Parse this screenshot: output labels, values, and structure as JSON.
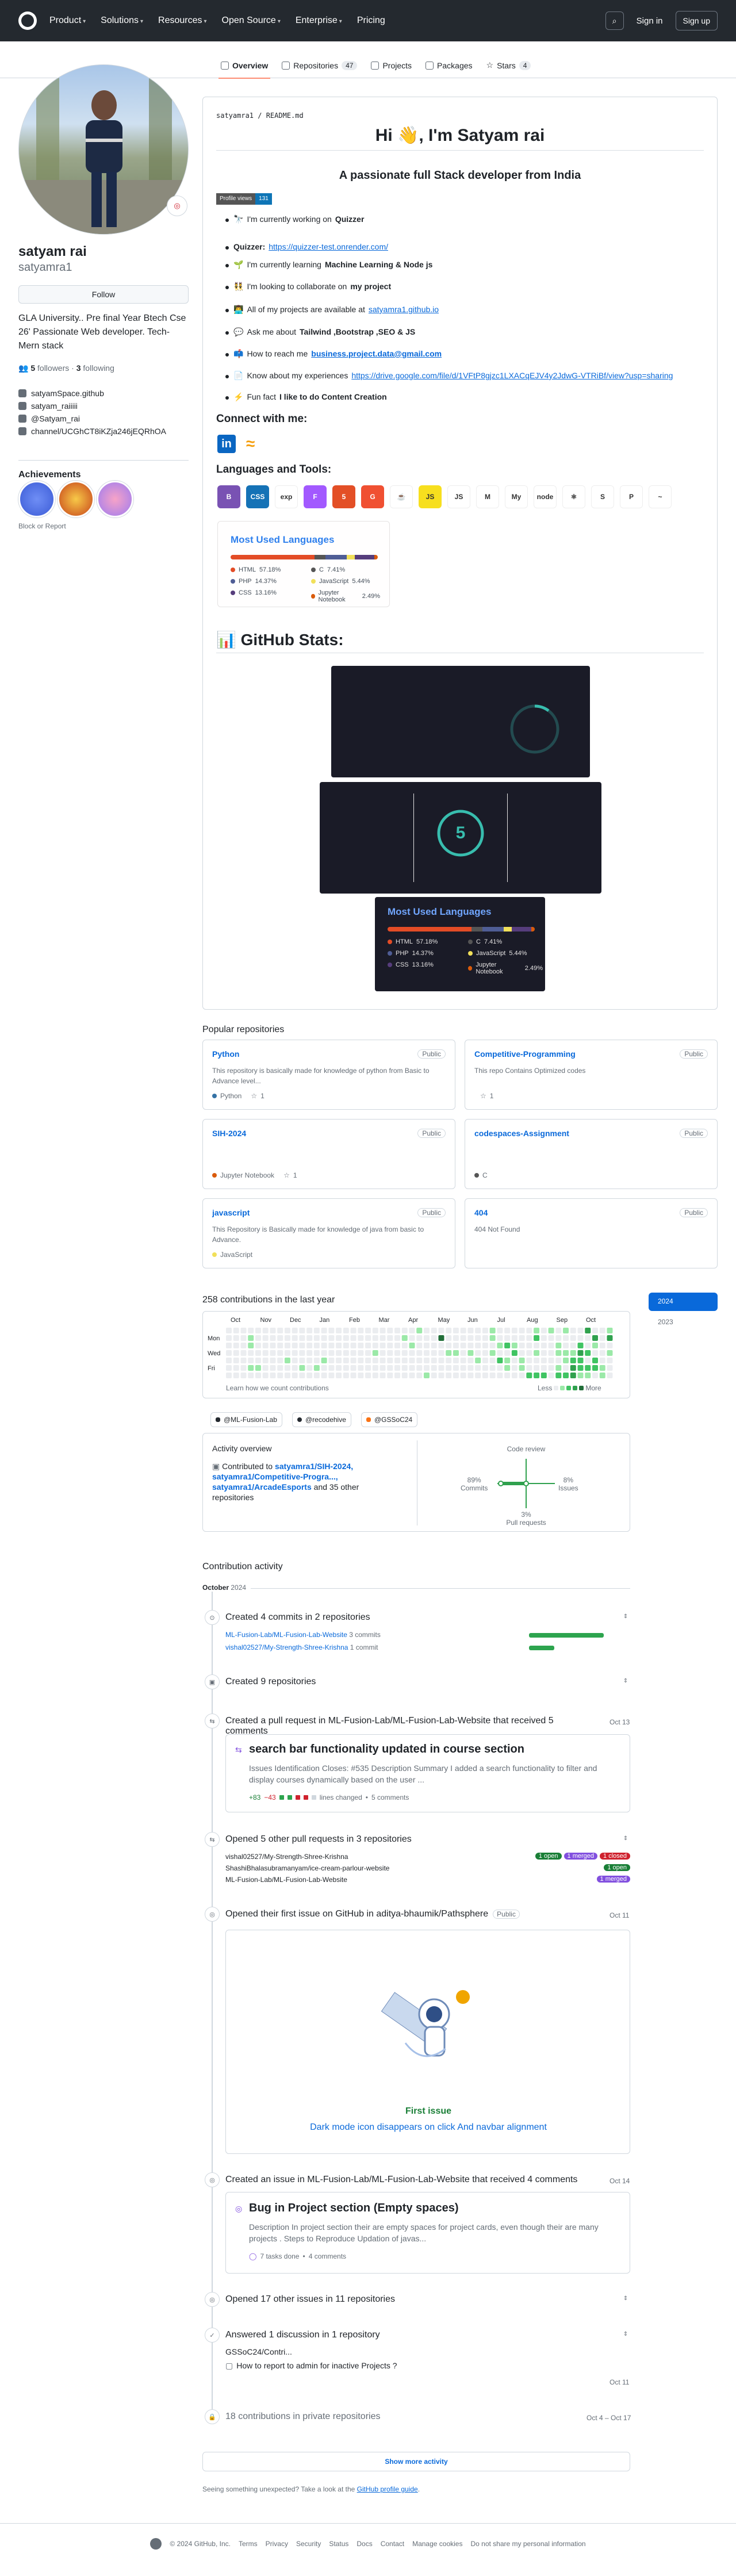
{
  "header": {
    "nav": [
      "Product",
      "Solutions",
      "Resources",
      "Open Source",
      "Enterprise",
      "Pricing"
    ],
    "signin": "Sign in",
    "signup": "Sign up"
  },
  "tabs": [
    {
      "label": "Overview"
    },
    {
      "label": "Repositories",
      "count": "47"
    },
    {
      "label": "Projects"
    },
    {
      "label": "Packages"
    },
    {
      "label": "Stars",
      "count": "4"
    }
  ],
  "profile": {
    "name": "satyam rai",
    "login": "satyamra1",
    "follow": "Follow",
    "bio": "GLA University.. Pre final Year Btech Cse 26' Passionate Web developer. Tech-Mern stack",
    "followers": "5",
    "followers_label": "followers",
    "following": "3",
    "following_label": "following",
    "links": [
      "satyamSpace.github",
      "satyam_raiiiii",
      "@Satyam_rai",
      "channel/UCGhCT8iKZja246jEQRhOA"
    ],
    "achievements_title": "Achievements",
    "block": "Block or Report"
  },
  "readme": {
    "path": "satyamra1 / README.md",
    "title": "Hi 👋, I'm Satyam rai",
    "subtitle": "A passionate full Stack developer from India",
    "views_label": "Profile views",
    "views": "131",
    "bullets": [
      {
        "icon": "🔭",
        "pre": "I'm currently working on ",
        "b": "Quizzer",
        "link": ""
      },
      {
        "icon": "",
        "pre": "",
        "b": "Quizzer: ",
        "link": "https://quizzer-test.onrender.com/"
      },
      {
        "icon": "🌱",
        "pre": "I'm currently learning ",
        "b": "Machine Learning & Node js",
        "link": ""
      },
      {
        "icon": "👯",
        "pre": "I'm looking to collaborate on ",
        "b": "my project",
        "link": ""
      },
      {
        "icon": "👨‍💻",
        "pre": "All of my projects are available at ",
        "b": "",
        "link": "satyamra1.github.io"
      },
      {
        "icon": "💬",
        "pre": "Ask me about ",
        "b": "Tailwind ,Bootstrap ,SEO & JS",
        "link": ""
      },
      {
        "icon": "📫",
        "pre": "How to reach me ",
        "b": "",
        "link": "business.project.data@gmail.com"
      },
      {
        "icon": "📄",
        "pre": "Know about my experiences ",
        "b": "",
        "link": "https://drive.google.com/file/d/1VFtP8gjzc1LXACqEJV4y2JdwG-VTRiBf/view?usp=sharing"
      },
      {
        "icon": "⚡",
        "pre": "Fun fact ",
        "b": "I like to do Content Creation",
        "link": ""
      }
    ],
    "connect": "Connect with me:",
    "lang_tools": "Languages and Tools:",
    "tools": [
      {
        "t": "B",
        "c": "#7952b3"
      },
      {
        "t": "CSS",
        "c": "#1572b6"
      },
      {
        "t": "exp",
        "c": "#ffffff"
      },
      {
        "t": "F",
        "c": "#a259ff"
      },
      {
        "t": "5",
        "c": "#e34f26"
      },
      {
        "t": "G",
        "c": "#f05032"
      },
      {
        "t": "☕",
        "c": "#ffffff"
      },
      {
        "t": "JS",
        "c": "#f7df1e"
      },
      {
        "t": "JS",
        "c": "#ffffff"
      },
      {
        "t": "M",
        "c": "#ffffff"
      },
      {
        "t": "My",
        "c": "#ffffff"
      },
      {
        "t": "node",
        "c": "#ffffff"
      },
      {
        "t": "⚛",
        "c": "#ffffff"
      },
      {
        "t": "S",
        "c": "#ffffff"
      },
      {
        "t": "P",
        "c": "#ffffff"
      },
      {
        "t": "~",
        "c": "#ffffff"
      }
    ],
    "stats_title": "📊 GitHub Stats:",
    "streak_num": "5"
  },
  "languages": {
    "title": "Most Used Languages",
    "items": [
      {
        "name": "HTML",
        "pct": "57.18%",
        "value": 57.18,
        "color": "#e34c26"
      },
      {
        "name": "C",
        "pct": "7.41%",
        "value": 7.41,
        "color": "#555555"
      },
      {
        "name": "PHP",
        "pct": "14.37%",
        "value": 14.37,
        "color": "#4F5D95"
      },
      {
        "name": "JavaScript",
        "pct": "5.44%",
        "value": 5.44,
        "color": "#f1e05a"
      },
      {
        "name": "CSS",
        "pct": "13.16%",
        "value": 13.16,
        "color": "#563d7c"
      },
      {
        "name": "Jupyter Notebook",
        "pct": "2.49%",
        "value": 2.49,
        "color": "#DA5B0B"
      }
    ]
  },
  "popular": {
    "title": "Popular repositories",
    "repos": [
      {
        "name": "Python",
        "vis": "Public",
        "desc": "This repository is basically made for knowledge of python from Basic to Advance level...",
        "lang": "Python",
        "lang_color": "#3572A5",
        "stars": "1"
      },
      {
        "name": "Competitive-Programming",
        "vis": "Public",
        "desc": "This repo Contains Optimized codes",
        "lang": "",
        "lang_color": "",
        "stars": "1"
      },
      {
        "name": "SIH-2024",
        "vis": "Public",
        "desc": "",
        "lang": "Jupyter Notebook",
        "lang_color": "#DA5B0B",
        "stars": "1"
      },
      {
        "name": "codespaces-Assignment",
        "vis": "Public",
        "desc": "",
        "lang": "C",
        "lang_color": "#555555",
        "stars": ""
      },
      {
        "name": "javascript",
        "vis": "Public",
        "desc": "This Repository is Basically made for knowledge of java from basic to Advance.",
        "lang": "JavaScript",
        "lang_color": "#f1e05a",
        "stars": ""
      },
      {
        "name": "404",
        "vis": "Public",
        "desc": "404 Not Found",
        "lang": "",
        "lang_color": "",
        "stars": ""
      }
    ]
  },
  "contrib": {
    "title": "258 contributions in the last year",
    "months": [
      "Oct",
      "Nov",
      "Dec",
      "Jan",
      "Feb",
      "Mar",
      "Apr",
      "May",
      "Jun",
      "Jul",
      "Aug",
      "Sep",
      "Oct"
    ],
    "days": [
      "Mon",
      "Wed",
      "Fri"
    ],
    "learn": "Learn how we count contributions",
    "less": "Less",
    "more": "More",
    "years": [
      "2024",
      "2023"
    ],
    "orgs": [
      "@ML-Fusion-Lab",
      "@recodehive",
      "@GSSoC24"
    ],
    "overview_title": "Activity overview",
    "contributed": "Contributed to",
    "repos": "satyamra1/SIH-2024, satyamra1/Competitive-Progra..., satyamra1/ArcadeEsports",
    "others": "and 35 other repositories",
    "axis": {
      "code_review": "Code review",
      "commits": "Commits",
      "commits_pct": "89%",
      "issues": "Issues",
      "issues_pct": "8%",
      "prs": "Pull requests",
      "prs_pct": "3%"
    }
  },
  "activity": {
    "title": "Contribution activity",
    "month": "October",
    "year": "2024",
    "commits": "Created 4 commits in 2 repositories",
    "c1": "ML-Fusion-Lab/ML-Fusion-Lab-Website",
    "c1n": "3 commits",
    "c2": "vishal02527/My-Strength-Shree-Krishna",
    "c2n": "1 commit",
    "created_repos": "Created 9 repositories",
    "pr_created": "Created a pull request in ML-Fusion-Lab/ML-Fusion-Lab-Website that received 5 comments",
    "pr_date": "Oct 13",
    "pr_title": "search bar functionality updated in course section",
    "pr_desc": "Issues Identification Closes: #535 Description Summary I added a search functionality to filter and display courses dynamically based on the user ...",
    "pr_plus": "+83",
    "pr_minus": "−43",
    "pr_changed": "lines changed",
    "pr_comments": "5 comments",
    "opened_prs": "Opened 5 other pull requests in 3 repositories",
    "op": [
      {
        "r": "vishal02527/My-Strength-Shree-Krishna",
        "a": "1 open",
        "b": "1 merged",
        "c": "1 closed"
      },
      {
        "r": "ShashiBhalasubramanyam/ice-cream-parlour-website",
        "a": "1 open",
        "b": "",
        "c": ""
      },
      {
        "r": "ML-Fusion-Lab/ML-Fusion-Lab-Website",
        "a": "1 merged",
        "b": "",
        "c": ""
      }
    ],
    "first_issue": "Opened their first issue on GitHub in aditya-bhaumik/Pathsphere",
    "first_issue_vis": "Public",
    "first_issue_date": "Oct 11",
    "first_issue_label": "First issue",
    "first_issue_title": "Dark mode icon disappears on click And navbar alignment",
    "issue_created": "Created an issue in ML-Fusion-Lab/ML-Fusion-Lab-Website that received 4 comments",
    "issue_date": "Oct 14",
    "issue_title": "Bug in Project section (Empty spaces)",
    "issue_desc": "Description In project section their are empty spaces for project cards, even though their are many projects . Steps to Reproduce Updation of javas...",
    "issue_tasks": "7 tasks done",
    "issue_comments": "4 comments",
    "opened_issues": "Opened 17 other issues in 11 repositories",
    "answered": "Answered 1 discussion in 1 repository",
    "disc_repo": "GSSoC24/Contri...",
    "disc_q": "How to report to admin for inactive Projects ?",
    "disc_date": "Oct 11",
    "private": "18 contributions in private repositories",
    "private_date": "Oct 4 – Oct 17",
    "more": "Show more activity",
    "unexpected": "Seeing something unexpected? Take a look at the",
    "guide": "GitHub profile guide"
  },
  "footer": [
    "© 2024 GitHub, Inc.",
    "Terms",
    "Privacy",
    "Security",
    "Status",
    "Docs",
    "Contact",
    "Manage cookies",
    "Do not share my personal information"
  ]
}
